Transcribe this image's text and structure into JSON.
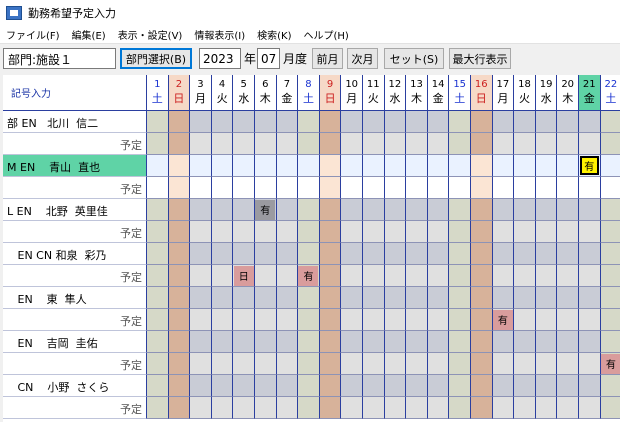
{
  "window": {
    "title": "勤務希望予定入力"
  },
  "menu": [
    "ファイル(F)",
    "編集(E)",
    "表示・設定(V)",
    "情報表示(I)",
    "検索(K)",
    "ヘルプ(H)"
  ],
  "toolbar": {
    "department": "部門:施設１",
    "dept_select_label": "部門選択(B)",
    "year": "2023",
    "year_label": "年",
    "month": "07",
    "month_label": "月度",
    "prev_month": "前月",
    "next_month": "次月",
    "set_label": "セット(S)",
    "max_rows_label": "最大行表示"
  },
  "grid": {
    "header_label": "記号入力",
    "plan_label": "予定",
    "days": [
      {
        "d": "1",
        "w": "土",
        "type": "sat"
      },
      {
        "d": "2",
        "w": "日",
        "type": "sun"
      },
      {
        "d": "3",
        "w": "月",
        "type": ""
      },
      {
        "d": "4",
        "w": "火",
        "type": ""
      },
      {
        "d": "5",
        "w": "水",
        "type": ""
      },
      {
        "d": "6",
        "w": "木",
        "type": ""
      },
      {
        "d": "7",
        "w": "金",
        "type": ""
      },
      {
        "d": "8",
        "w": "土",
        "type": "sat"
      },
      {
        "d": "9",
        "w": "日",
        "type": "sun"
      },
      {
        "d": "10",
        "w": "月",
        "type": ""
      },
      {
        "d": "11",
        "w": "火",
        "type": ""
      },
      {
        "d": "12",
        "w": "水",
        "type": ""
      },
      {
        "d": "13",
        "w": "木",
        "type": ""
      },
      {
        "d": "14",
        "w": "金",
        "type": ""
      },
      {
        "d": "15",
        "w": "土",
        "type": "sat"
      },
      {
        "d": "16",
        "w": "日",
        "type": "sun"
      },
      {
        "d": "17",
        "w": "月",
        "type": ""
      },
      {
        "d": "18",
        "w": "火",
        "type": ""
      },
      {
        "d": "19",
        "w": "水",
        "type": ""
      },
      {
        "d": "20",
        "w": "木",
        "type": ""
      },
      {
        "d": "21",
        "w": "金",
        "type": "hl"
      },
      {
        "d": "22",
        "w": "土",
        "type": "sat"
      }
    ],
    "employees": [
      {
        "name": "部 EN   北川  信二",
        "selected": false,
        "marks": [],
        "plan_marks": []
      },
      {
        "name": "M EN    青山  直也",
        "selected": true,
        "marks": [
          {
            "day": 20,
            "text": "有",
            "style": "yellow"
          }
        ],
        "plan_marks": []
      },
      {
        "name": "L EN    北野  英里佳",
        "selected": false,
        "marks": [
          {
            "day": 5,
            "text": "有",
            "style": "gray"
          }
        ],
        "plan_marks": []
      },
      {
        "name": "   EN CN 和泉  彩乃",
        "selected": false,
        "marks": [],
        "plan_marks": [
          {
            "day": 4,
            "text": "日",
            "style": "pink"
          },
          {
            "day": 7,
            "text": "有",
            "style": "pink"
          }
        ]
      },
      {
        "name": "   EN    東  隼人",
        "selected": false,
        "marks": [],
        "plan_marks": [
          {
            "day": 16,
            "text": "有",
            "style": "pink"
          }
        ]
      },
      {
        "name": "   EN    吉岡  圭佑",
        "selected": false,
        "marks": [],
        "plan_marks": [
          {
            "day": 21,
            "text": "有",
            "style": "pink"
          }
        ]
      },
      {
        "name": "   CN    小野  さくら",
        "selected": false,
        "marks": [],
        "plan_marks": []
      }
    ]
  }
}
